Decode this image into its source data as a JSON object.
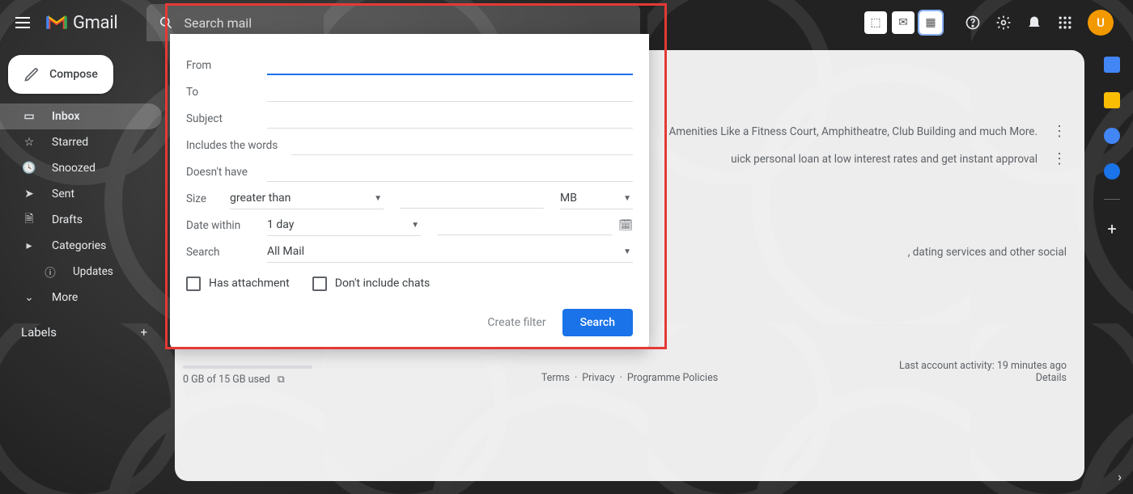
{
  "header": {
    "product_name": "Gmail",
    "search_placeholder": "Search mail",
    "avatar_initial": "U"
  },
  "sidebar": {
    "compose_label": "Compose",
    "items": [
      {
        "label": "Inbox"
      },
      {
        "label": "Starred"
      },
      {
        "label": "Snoozed"
      },
      {
        "label": "Sent"
      },
      {
        "label": "Drafts"
      },
      {
        "label": "Categories"
      },
      {
        "label": "Updates"
      },
      {
        "label": "More"
      }
    ],
    "labels_header": "Labels"
  },
  "advanced_search": {
    "fields": {
      "from_label": "From",
      "to_label": "To",
      "subject_label": "Subject",
      "includes_label": "Includes the words",
      "excludes_label": "Doesn't have",
      "size_label": "Size",
      "size_operator": "greater than",
      "size_unit": "MB",
      "date_label": "Date within",
      "date_range": "1 day",
      "search_in_label": "Search",
      "search_in_value": "All Mail"
    },
    "checkboxes": {
      "has_attachment": "Has attachment",
      "exclude_chats": "Don't include chats"
    },
    "actions": {
      "create_filter": "Create filter",
      "search": "Search"
    }
  },
  "mail_rows": [
    {
      "snippet": "Amenities Like a Fitness Court, Amphitheatre, Club Building and much More."
    },
    {
      "snippet": "uick personal loan at low interest rates and get instant approval"
    },
    {
      "snippet": ", dating services and other social"
    }
  ],
  "footer": {
    "terms": "Terms",
    "privacy": "Privacy",
    "policies": "Programme Policies",
    "activity": "Last account activity: 19 minutes ago",
    "details": "Details",
    "storage": "0 GB of 15 GB used"
  }
}
